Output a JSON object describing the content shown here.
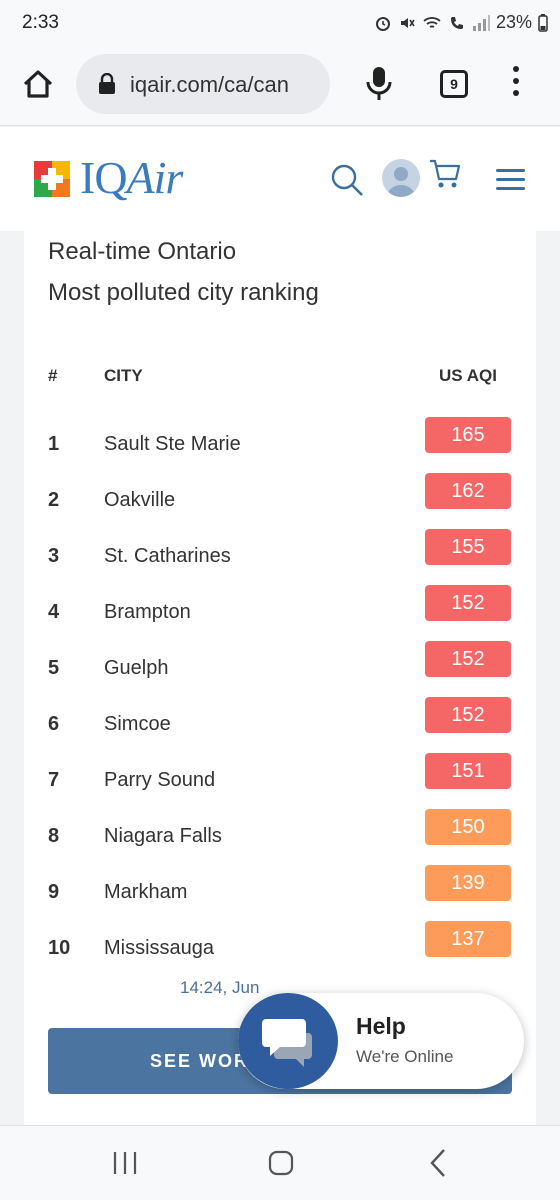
{
  "status_bar": {
    "time": "2:33",
    "battery": "23%"
  },
  "browser": {
    "url": "iqair.com/ca/can",
    "tab_count": "9"
  },
  "header": {
    "logo_iq": "IQ",
    "logo_air": "Air"
  },
  "ranking": {
    "title_line1": "Real-time Ontario",
    "title_line2": "Most polluted city ranking",
    "columns": {
      "rank": "#",
      "city": "CITY",
      "aqi": "US AQI"
    },
    "rows": [
      {
        "rank": "1",
        "city": "Sault Ste Marie",
        "aqi": "165",
        "color": "#f56666"
      },
      {
        "rank": "2",
        "city": "Oakville",
        "aqi": "162",
        "color": "#f56666"
      },
      {
        "rank": "3",
        "city": "St. Catharines",
        "aqi": "155",
        "color": "#f56666"
      },
      {
        "rank": "4",
        "city": "Brampton",
        "aqi": "152",
        "color": "#f56666"
      },
      {
        "rank": "5",
        "city": "Guelph",
        "aqi": "152",
        "color": "#f56666"
      },
      {
        "rank": "6",
        "city": "Simcoe",
        "aqi": "152",
        "color": "#f56666"
      },
      {
        "rank": "7",
        "city": "Parry Sound",
        "aqi": "151",
        "color": "#f56666"
      },
      {
        "rank": "8",
        "city": "Niagara Falls",
        "aqi": "150",
        "color": "#fd9b5a"
      },
      {
        "rank": "9",
        "city": "Markham",
        "aqi": "139",
        "color": "#fd9b5a"
      },
      {
        "rank": "10",
        "city": "Mississauga",
        "aqi": "137",
        "color": "#fd9b5a"
      }
    ],
    "timestamp": "14:24, Jun",
    "see_button": "SEE WORL"
  },
  "help_widget": {
    "title": "Help",
    "subtitle": "We're Online"
  },
  "colors": {
    "unhealthy": "#f56666",
    "sensitive": "#fd9b5a",
    "brand_blue": "#3a7bbf",
    "button_blue": "#4c74a0"
  }
}
